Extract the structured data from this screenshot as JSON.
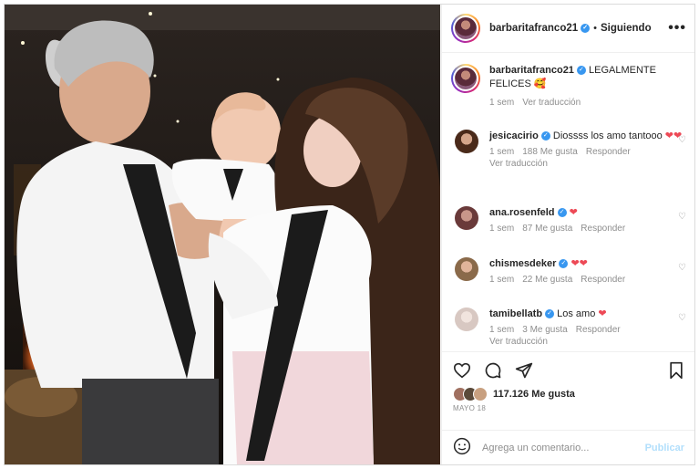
{
  "post": {
    "author": "barbaritafranco21",
    "follow_status": "Siguiendo",
    "more_label": "•••",
    "caption_text": "LEGALMENTE FELICES 🥰",
    "caption_time": "1 sem",
    "caption_translate": "Ver traducción"
  },
  "comments": [
    {
      "user": "jesicacirio",
      "text": "Diossss los amo tantooo",
      "hearts": "❤❤",
      "time": "1 sem",
      "likes": "188 Me gusta",
      "reply": "Responder",
      "translate": "Ver traducción"
    },
    {
      "user": "ana.rosenfeld",
      "text": "",
      "hearts": "❤",
      "time": "1 sem",
      "likes": "87 Me gusta",
      "reply": "Responder",
      "translate": ""
    },
    {
      "user": "chismesdeker",
      "text": "",
      "hearts": "❤❤",
      "time": "1 sem",
      "likes": "22 Me gusta",
      "reply": "Responder",
      "translate": ""
    },
    {
      "user": "tamibellatb",
      "text": "Los amo",
      "hearts": "❤",
      "time": "1 sem",
      "likes": "3 Me gusta",
      "reply": "Responder",
      "translate": "Ver traducción"
    }
  ],
  "engagement": {
    "likes_count": "117.126 Me gusta",
    "date": "MAYO 18"
  },
  "composer": {
    "placeholder": "Agrega un comentario...",
    "publish_label": "Publicar"
  },
  "icons": [
    "heart-icon",
    "comment-icon",
    "share-icon",
    "bookmark-icon",
    "emoji-icon",
    "verified-icon",
    "more-options-icon"
  ],
  "colors": {
    "verified": "#3897f0",
    "heart": "#ed4956",
    "publish_disabled": "#b2dffc",
    "meta_text": "#8e8e8e"
  }
}
